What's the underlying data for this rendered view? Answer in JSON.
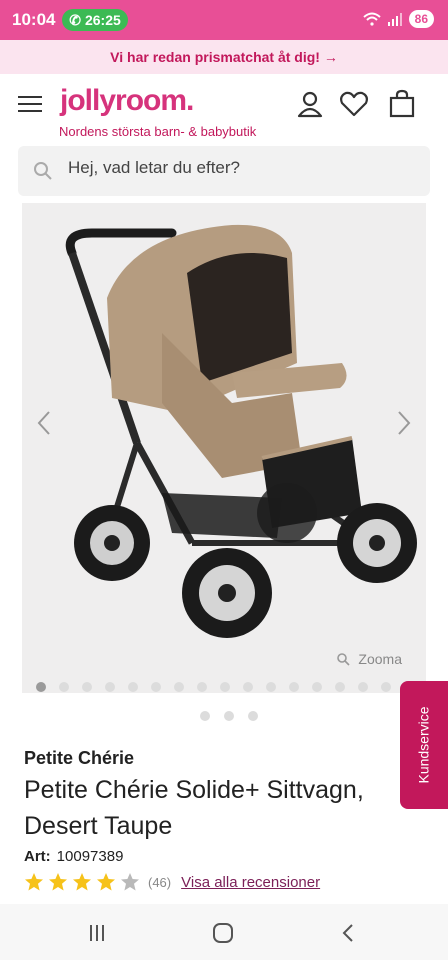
{
  "status": {
    "time": "10:04",
    "call_timer": "26:25",
    "battery": "86"
  },
  "promo": {
    "text": "Vi har redan prismatchat åt dig! →"
  },
  "header": {
    "logo": "jollyroom.",
    "tagline": "Nordens största barn- & babybutik"
  },
  "search": {
    "placeholder": "Hej, vad letar du efter?"
  },
  "gallery": {
    "zoom_label": "Zooma",
    "image_count": 17,
    "active_index": 0
  },
  "kundservice": {
    "label": "Kundservice"
  },
  "product": {
    "brand": "Petite Chérie",
    "title": "Petite Chérie Solide+ Sittvagn, Desert Taupe",
    "art_label": "Art:",
    "art_number": "10097389",
    "rating": 4,
    "rating_max": 5,
    "review_count": "(46)",
    "reviews_link": "Visa alla recensioner"
  },
  "colors": {
    "brand_pink": "#e84f96",
    "accent": "#c2185b",
    "star": "#f6c21a"
  }
}
